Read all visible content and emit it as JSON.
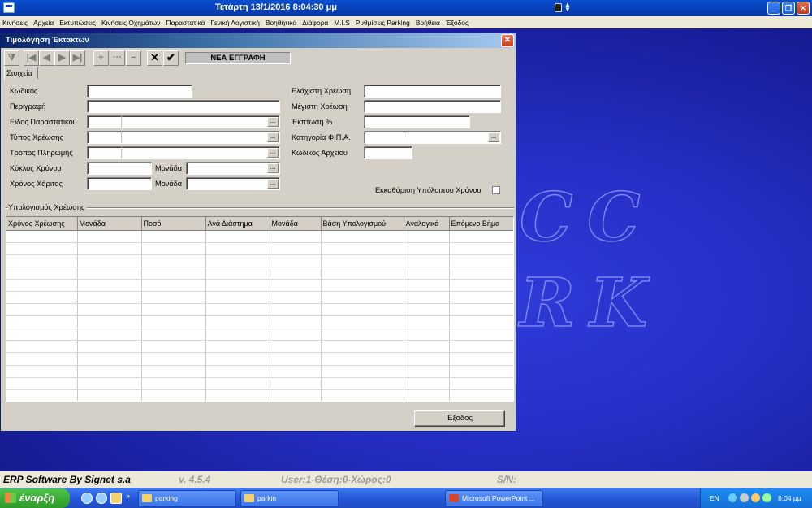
{
  "titlebar": {
    "text": "Τετάρτη  13/1/2016 8:04:30 μμ"
  },
  "menu": [
    "Κινήσεις",
    "Αρχεία",
    "Εκτυπώσεις",
    "Κινήσεις Οχημάτων",
    "Παραστατικά",
    "Γενική Λογιστική",
    "Βοηθητικά",
    "Διάφορα",
    "M.I.S",
    "Ρυθμίσεις Parking",
    "Βοήθεια",
    "Έξοδος"
  ],
  "watermark": {
    "line1": "CC",
    "line2": "RK"
  },
  "dialog": {
    "title": "Τιμολόγηση Έκτακτων",
    "record_state": "ΝΕΑ ΕΓΓΡΑΦΗ",
    "tab": "Στοιχεία",
    "fields": {
      "code": "Κωδικός",
      "description": "Περιγραφή",
      "document_type": "Είδος Παραστατικού",
      "charge_type": "Τύπος Χρέωσης",
      "payment_method": "Τρόπος Πληρωμής",
      "time_cycle": "Κύκλος Χρόνου",
      "grace_time": "Χρόνος Χάριτος",
      "unit1": "Μονάδα",
      "unit2": "Μονάδα",
      "min_charge": "Ελάχιστη Χρέωση",
      "max_charge": "Μέγιστη Χρέωση",
      "discount": "Έκπτωση %",
      "vat_category": "Κατηγορία Φ.Π.Α.",
      "file_code": "Κωδικός Αρχείου",
      "clear_remaining": "Εκκαθάριση Υπόλοιπου Χρόνου"
    },
    "group_label": "Υπολογισμός Χρέωσης",
    "columns": [
      "Χρόνος Χρέωσης",
      "Μονάδα",
      "Ποσό",
      "Ανά Διάστημα",
      "Μονάδα",
      "Βάση Υπολογισμού",
      "Αναλογικά",
      "Επόμενο Βήμα"
    ],
    "exit_label": "Έξοδος"
  },
  "status": {
    "company": "ERP Software By Signet s.a",
    "version": "v. 4.5.4",
    "user": "User:1-Θέση:0-Χώρος:0",
    "sn": "S/N:"
  },
  "taskbar": {
    "start": "έναρξη",
    "tasks": [
      "parking",
      "parkin",
      "Microsoft PowerPoint ..."
    ],
    "lang": "EN",
    "clock": "8:04 μμ"
  }
}
